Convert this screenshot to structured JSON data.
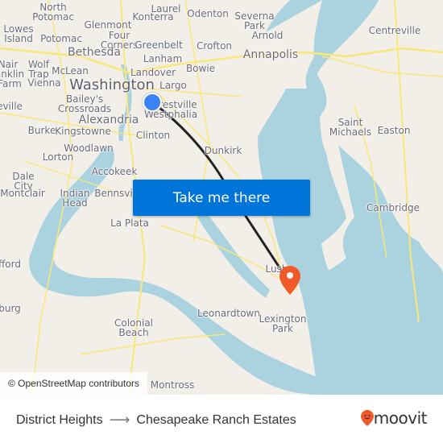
{
  "map": {
    "attribution": "© OpenStreetMap contributors",
    "colors": {
      "land": "#f2efe9",
      "water": "#aad3df",
      "road": "#f9e77a",
      "route": "#222222",
      "origin": "#3b82f6",
      "destination": "#f05a28"
    },
    "places": [
      {
        "name": "North\nPotomac",
        "size": "normal"
      },
      {
        "name": "Lowes\nIsland",
        "size": "normal"
      },
      {
        "name": "Potomac",
        "size": "normal"
      },
      {
        "name": "Glenmont",
        "size": "normal"
      },
      {
        "name": "Four\nCorners",
        "size": "normal"
      },
      {
        "name": "Laurel",
        "size": "normal"
      },
      {
        "name": "Konterra",
        "size": "normal"
      },
      {
        "name": "Odenton",
        "size": "normal"
      },
      {
        "name": "Severna\nPark",
        "size": "normal"
      },
      {
        "name": "Arnold",
        "size": "normal"
      },
      {
        "name": "Centreville",
        "size": "normal"
      },
      {
        "name": "Bethesda",
        "size": "mid"
      },
      {
        "name": "Greenbelt",
        "size": "normal"
      },
      {
        "name": "Crofton",
        "size": "normal"
      },
      {
        "name": "Annapolis",
        "size": "mid"
      },
      {
        "name": "Lanham",
        "size": "normal"
      },
      {
        "name": "Bowie",
        "size": "normal"
      },
      {
        "name": "Nair",
        "size": "normal"
      },
      {
        "name": "Wolf\nTrap",
        "size": "normal"
      },
      {
        "name": "McLean",
        "size": "normal"
      },
      {
        "name": "Landover",
        "size": "normal"
      },
      {
        "name": "anklin\nFarm",
        "size": "normal"
      },
      {
        "name": "Vienna",
        "size": "normal"
      },
      {
        "name": "Washington",
        "size": "big"
      },
      {
        "name": "Largo",
        "size": "normal"
      },
      {
        "name": "Bailey's\nCrossroads",
        "size": "normal"
      },
      {
        "name": "Forestville",
        "size": "normal"
      },
      {
        "name": "eville",
        "size": "normal"
      },
      {
        "name": "Westphalia",
        "size": "normal"
      },
      {
        "name": "Alexandria",
        "size": "mid"
      },
      {
        "name": "Saint\nMichaels",
        "size": "normal"
      },
      {
        "name": "Easton",
        "size": "normal"
      },
      {
        "name": "Burke",
        "size": "normal"
      },
      {
        "name": "Kingstowne",
        "size": "normal"
      },
      {
        "name": "Clinton",
        "size": "normal"
      },
      {
        "name": "Woodlawn",
        "size": "normal"
      },
      {
        "name": "Dunkirk",
        "size": "normal"
      },
      {
        "name": "Lorton",
        "size": "normal"
      },
      {
        "name": "Accokeek",
        "size": "normal"
      },
      {
        "name": "Dale\nCity",
        "size": "normal"
      },
      {
        "name": "Montclair",
        "size": "normal"
      },
      {
        "name": "Indian\nHead",
        "size": "normal"
      },
      {
        "name": "Bennsville",
        "size": "normal"
      },
      {
        "name": "Cambridge",
        "size": "normal"
      },
      {
        "name": "La Plata",
        "size": "normal"
      },
      {
        "name": "fford",
        "size": "normal"
      },
      {
        "name": "Lusby",
        "size": "normal"
      },
      {
        "name": "burg",
        "size": "normal"
      },
      {
        "name": "Leonardtown",
        "size": "normal"
      },
      {
        "name": "Lexington\nPark",
        "size": "normal"
      },
      {
        "name": "Colonial\nBeach",
        "size": "normal"
      },
      {
        "name": "Montross",
        "size": "normal"
      }
    ]
  },
  "cta": {
    "label": "Take me there"
  },
  "footer": {
    "origin": "District Heights",
    "arrow": "⟶",
    "destination": "Chesapeake Ranch Estates",
    "brand": "moovit",
    "brand_color": "#f05a28"
  }
}
